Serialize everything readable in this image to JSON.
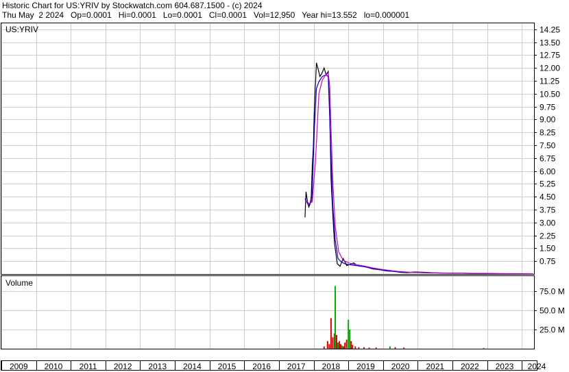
{
  "header": {
    "line1": "Historic Chart for US:YRIV by Stockwatch.com 604.687.1500 - (c) 2024",
    "line2": "Thu May  2 2024   Op=0.0001   Hi=0.0001   Lo=0.0001   Cl=0.0001   Vol=12,950   Year hi=13.552   lo=0.000001"
  },
  "price_panel": {
    "label": "US:YRIV"
  },
  "volume_panel": {
    "label": "Volume"
  },
  "colors": {
    "price": "#000000",
    "ma_short": "#cc00cc",
    "ma_long": "#0000cc",
    "grid": "#cccccc",
    "vol_up": "#00aa00",
    "vol_down": "#dd0000"
  },
  "chart_data": [
    {
      "type": "line",
      "title": "US:YRIV",
      "y_ticks": [
        "14.25",
        "13.50",
        "12.75",
        "12.00",
        "11.25",
        "10.50",
        "9.75",
        "9.00",
        "8.25",
        "7.50",
        "6.75",
        "6.00",
        "5.25",
        "4.50",
        "3.75",
        "3.00",
        "2.25",
        "1.50",
        "0.75"
      ],
      "ylim": [
        0,
        14.6
      ],
      "x_ticks": [
        "2009",
        "2010",
        "2011",
        "2012",
        "2013",
        "2014",
        "2015",
        "2016",
        "2017",
        "2018",
        "2019",
        "2020",
        "2021",
        "2022",
        "2023",
        "2024"
      ],
      "xlim": [
        2009.0,
        2024.35
      ],
      "grid": true,
      "series": [
        {
          "x": [
            2017.75,
            2017.78,
            2017.82,
            2017.86,
            2017.9,
            2017.93,
            2017.96,
            2017.99,
            2018.02,
            2018.05,
            2018.08,
            2018.12,
            2018.18,
            2018.24,
            2018.3,
            2018.36,
            2018.42,
            2018.46,
            2018.5,
            2018.55,
            2018.6,
            2018.68,
            2018.76,
            2018.85,
            2018.95,
            2019.05,
            2019.15,
            2019.25,
            2019.35,
            2019.5,
            2019.7,
            2019.9,
            2020.1,
            2020.3,
            2020.5,
            2020.7,
            2020.9,
            2021.2,
            2021.6,
            2022.0,
            2022.5,
            2023.0,
            2023.5,
            2024.0,
            2024.33
          ],
          "values": [
            3.3,
            4.8,
            4.2,
            3.9,
            4.1,
            4.5,
            6.3,
            7.4,
            9.8,
            11.0,
            12.3,
            12.0,
            11.5,
            11.7,
            12.0,
            11.6,
            11.8,
            9.5,
            5.5,
            3.5,
            1.8,
            0.6,
            0.45,
            0.9,
            0.5,
            0.55,
            0.65,
            0.5,
            0.45,
            0.42,
            0.3,
            0.25,
            0.18,
            0.15,
            0.1,
            0.08,
            0.12,
            0.1,
            0.06,
            0.05,
            0.04,
            0.03,
            0.02,
            0.01,
            0.0001
          ]
        },
        {
          "x": [
            2017.75,
            2017.85,
            2017.95,
            2018.02,
            2018.08,
            2018.15,
            2018.25,
            2018.35,
            2018.42,
            2018.48,
            2018.55,
            2018.62,
            2018.7,
            2018.8,
            2018.9,
            2019.0,
            2019.2,
            2019.4,
            2019.7,
            2020.0,
            2020.4,
            2020.8,
            2021.2,
            2022.0,
            2023.0,
            2024.33
          ],
          "values": [
            4.4,
            4.0,
            4.3,
            8.5,
            10.8,
            11.2,
            11.5,
            11.6,
            11.5,
            8.0,
            4.0,
            2.0,
            0.9,
            0.7,
            0.6,
            0.55,
            0.5,
            0.45,
            0.32,
            0.22,
            0.14,
            0.09,
            0.07,
            0.05,
            0.02,
            0.001
          ]
        },
        {
          "x": [
            2017.75,
            2017.88,
            2017.96,
            2018.05,
            2018.15,
            2018.25,
            2018.35,
            2018.42,
            2018.46,
            2018.5,
            2018.55,
            2018.62,
            2018.72,
            2018.85,
            2019.0,
            2019.2,
            2019.45,
            2019.7,
            2020.0,
            2020.4,
            2020.8,
            2021.3,
            2022.0,
            2023.0,
            2024.33
          ],
          "values": [
            4.3,
            4.1,
            4.2,
            6.5,
            10.5,
            11.3,
            11.6,
            11.7,
            11.0,
            8.5,
            5.5,
            2.8,
            1.3,
            0.8,
            0.65,
            0.55,
            0.47,
            0.36,
            0.26,
            0.16,
            0.1,
            0.07,
            0.05,
            0.02,
            0.001
          ]
        }
      ]
    },
    {
      "type": "bar",
      "title": "Volume",
      "y_ticks": [
        "75.0 M",
        "50.0 M",
        "25.0 M"
      ],
      "ylim": [
        0,
        95
      ],
      "x": [
        2018.3,
        2018.4,
        2018.45,
        2018.5,
        2018.55,
        2018.6,
        2018.62,
        2018.66,
        2018.7,
        2018.74,
        2018.78,
        2018.82,
        2018.86,
        2018.9,
        2018.95,
        2019.0,
        2019.04,
        2019.08,
        2019.12,
        2019.2,
        2019.3,
        2019.45,
        2019.6,
        2019.8,
        2020.2,
        2020.35,
        2020.6,
        2022.9
      ],
      "values": [
        3,
        10,
        6,
        40,
        15,
        20,
        82,
        18,
        8,
        10,
        6,
        4,
        3,
        8,
        12,
        38,
        25,
        10,
        5,
        3,
        2,
        2,
        1.5,
        1.5,
        3,
        2,
        1.5,
        1
      ],
      "up": [
        false,
        false,
        false,
        false,
        false,
        false,
        true,
        false,
        true,
        false,
        false,
        true,
        false,
        false,
        false,
        true,
        true,
        false,
        false,
        false,
        false,
        false,
        false,
        false,
        true,
        false,
        false,
        true
      ]
    }
  ]
}
